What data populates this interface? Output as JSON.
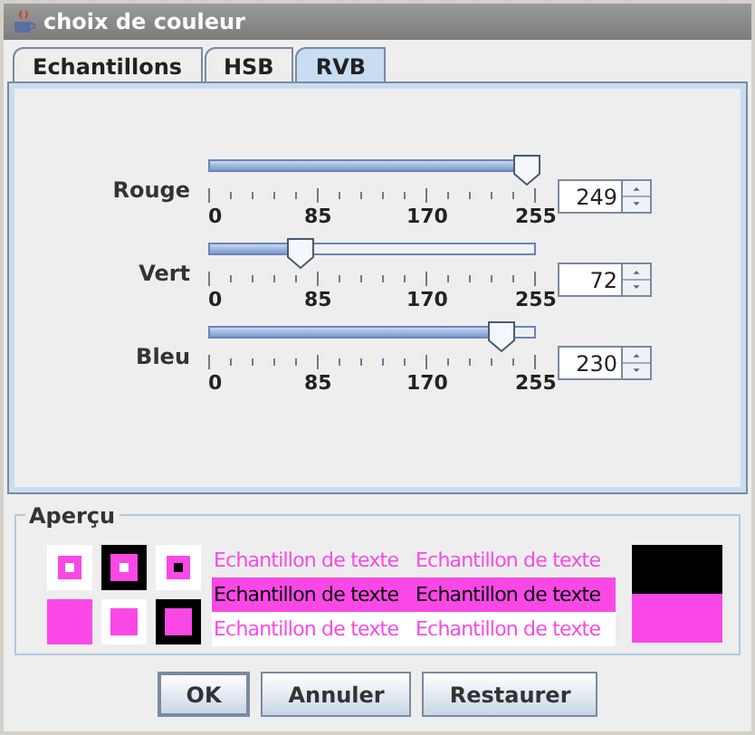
{
  "window": {
    "title": "choix de couleur"
  },
  "tabs": [
    {
      "label": "Echantillons",
      "selected": false
    },
    {
      "label": "HSB",
      "selected": false
    },
    {
      "label": "RVB",
      "selected": true
    }
  ],
  "channels": [
    {
      "name": "Rouge",
      "level": 0.976,
      "value": "249",
      "ticks": [
        "0",
        "85",
        "170",
        "255"
      ]
    },
    {
      "name": "Vert",
      "level": 0.282,
      "value": "72",
      "ticks": [
        "0",
        "85",
        "170",
        "255"
      ]
    },
    {
      "name": "Bleu",
      "level": 0.902,
      "value": "230",
      "ticks": [
        "0",
        "85",
        "170",
        "255"
      ]
    }
  ],
  "preview": {
    "title": "Aperçu",
    "samples": [
      "Echantillon de texte",
      "Echantillon de texte",
      "Echantillon de texte",
      "Echantillon de texte",
      "Echantillon de texte",
      "Echantillon de texte"
    ]
  },
  "buttons": [
    {
      "label": "OK",
      "selected": true
    },
    {
      "label": "Annuler",
      "selected": false
    },
    {
      "label": "Restaurer",
      "selected": false
    }
  ]
}
